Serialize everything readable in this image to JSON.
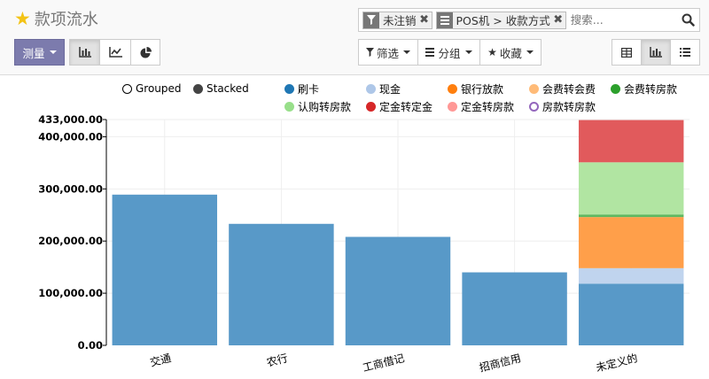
{
  "header": {
    "title": "款项流水"
  },
  "search": {
    "facets": [
      {
        "label": "未注销",
        "icon": "filter-icon"
      },
      {
        "label": "POS机 > 收款方式",
        "icon": "groupby-icon"
      }
    ],
    "placeholder": "搜索..."
  },
  "toolbar": {
    "measures_label": "测量",
    "filters_label": "筛选",
    "groupby_label": "分组",
    "favorites_label": "收藏"
  },
  "legend": {
    "modes": [
      {
        "label": "Grouped",
        "active": false
      },
      {
        "label": "Stacked",
        "active": true
      }
    ],
    "series": [
      {
        "label": "刷卡",
        "color": "#1f77b4"
      },
      {
        "label": "现金",
        "color": "#aec7e8"
      },
      {
        "label": "银行放款",
        "color": "#ff7f0e"
      },
      {
        "label": "会费转会费",
        "color": "#ffbb78"
      },
      {
        "label": "会费转房款",
        "color": "#2ca02c"
      },
      {
        "label": "认购转房款",
        "color": "#98df8a"
      },
      {
        "label": "定金转定金",
        "color": "#d62728"
      },
      {
        "label": "定金转房款",
        "color": "#ff9896"
      },
      {
        "label": "房款转房款",
        "color": "#9467bd",
        "disabled": true
      }
    ]
  },
  "chart_data": {
    "type": "bar",
    "stacked": true,
    "categories": [
      "交通",
      "农行",
      "工商借记",
      "招商信用",
      "未定义的"
    ],
    "ylim": [
      0,
      433000
    ],
    "y_ticks": [
      "433,000.00",
      "400,000.00",
      "300,000.00",
      "200,000.00",
      "100,000.00",
      "0.00"
    ],
    "y_tick_values": [
      433000,
      400000,
      300000,
      200000,
      100000,
      0
    ],
    "series": [
      {
        "name": "刷卡",
        "color": "#5899c8",
        "values": [
          289000,
          233000,
          208000,
          140000,
          118000
        ]
      },
      {
        "name": "现金",
        "color": "#c0d4ee",
        "values": [
          0,
          0,
          0,
          0,
          30000
        ]
      },
      {
        "name": "银行放款",
        "color": "#ff9f4a",
        "values": [
          0,
          0,
          0,
          0,
          98000
        ]
      },
      {
        "name": "会费转会费",
        "color": "#ffc990",
        "values": [
          0,
          0,
          0,
          0,
          0
        ]
      },
      {
        "name": "会费转房款",
        "color": "#60b860",
        "values": [
          0,
          0,
          0,
          0,
          5000
        ]
      },
      {
        "name": "认购转房款",
        "color": "#b1e5a2",
        "values": [
          0,
          0,
          0,
          0,
          100000
        ]
      },
      {
        "name": "定金转定金",
        "color": "#e15a5c",
        "values": [
          0,
          0,
          0,
          0,
          81000
        ]
      }
    ]
  }
}
